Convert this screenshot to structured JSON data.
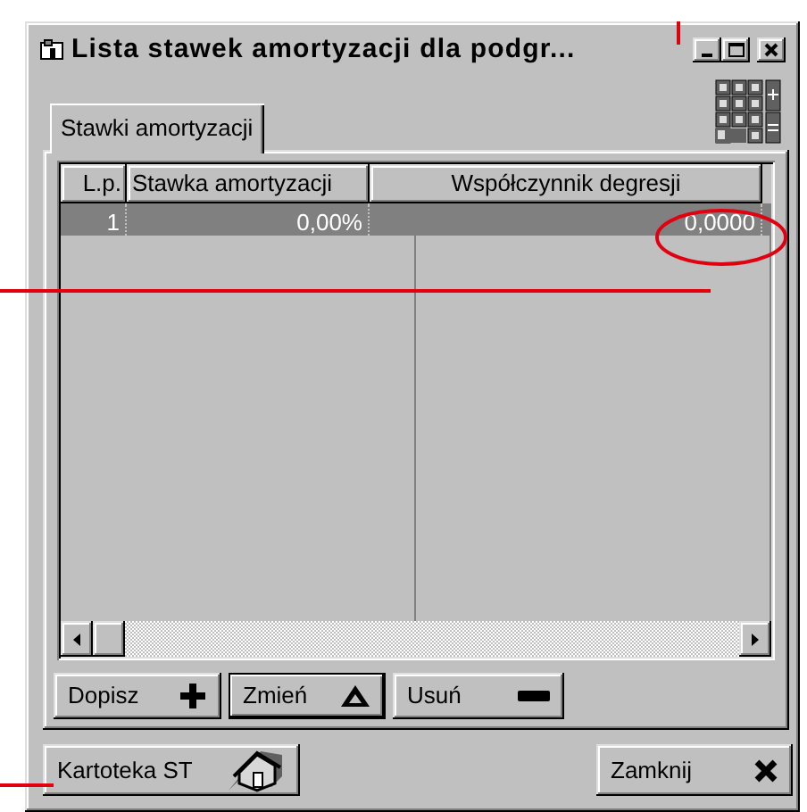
{
  "window": {
    "title": "Lista stawek amortyzacji dla podgr..."
  },
  "tabs": [
    {
      "label": "Stawki amortyzacji",
      "selected": true
    }
  ],
  "table": {
    "columns": [
      "L.p.",
      "Stawka amortyzacji",
      "Współczynnik degresji"
    ],
    "rows": [
      {
        "cells": [
          "1",
          "0,00%",
          "0,0000"
        ],
        "selected": true
      }
    ]
  },
  "row_buttons": [
    {
      "label": "Dopisz",
      "kind": "plus",
      "focused": false
    },
    {
      "label": "Zmień",
      "kind": "triangle",
      "focused": true
    },
    {
      "label": "Usuń",
      "kind": "minus",
      "focused": false
    }
  ],
  "footer_buttons": [
    {
      "label": "Kartoteka ST",
      "kind": "house"
    },
    {
      "label": "Zamknij",
      "kind": "close"
    }
  ]
}
